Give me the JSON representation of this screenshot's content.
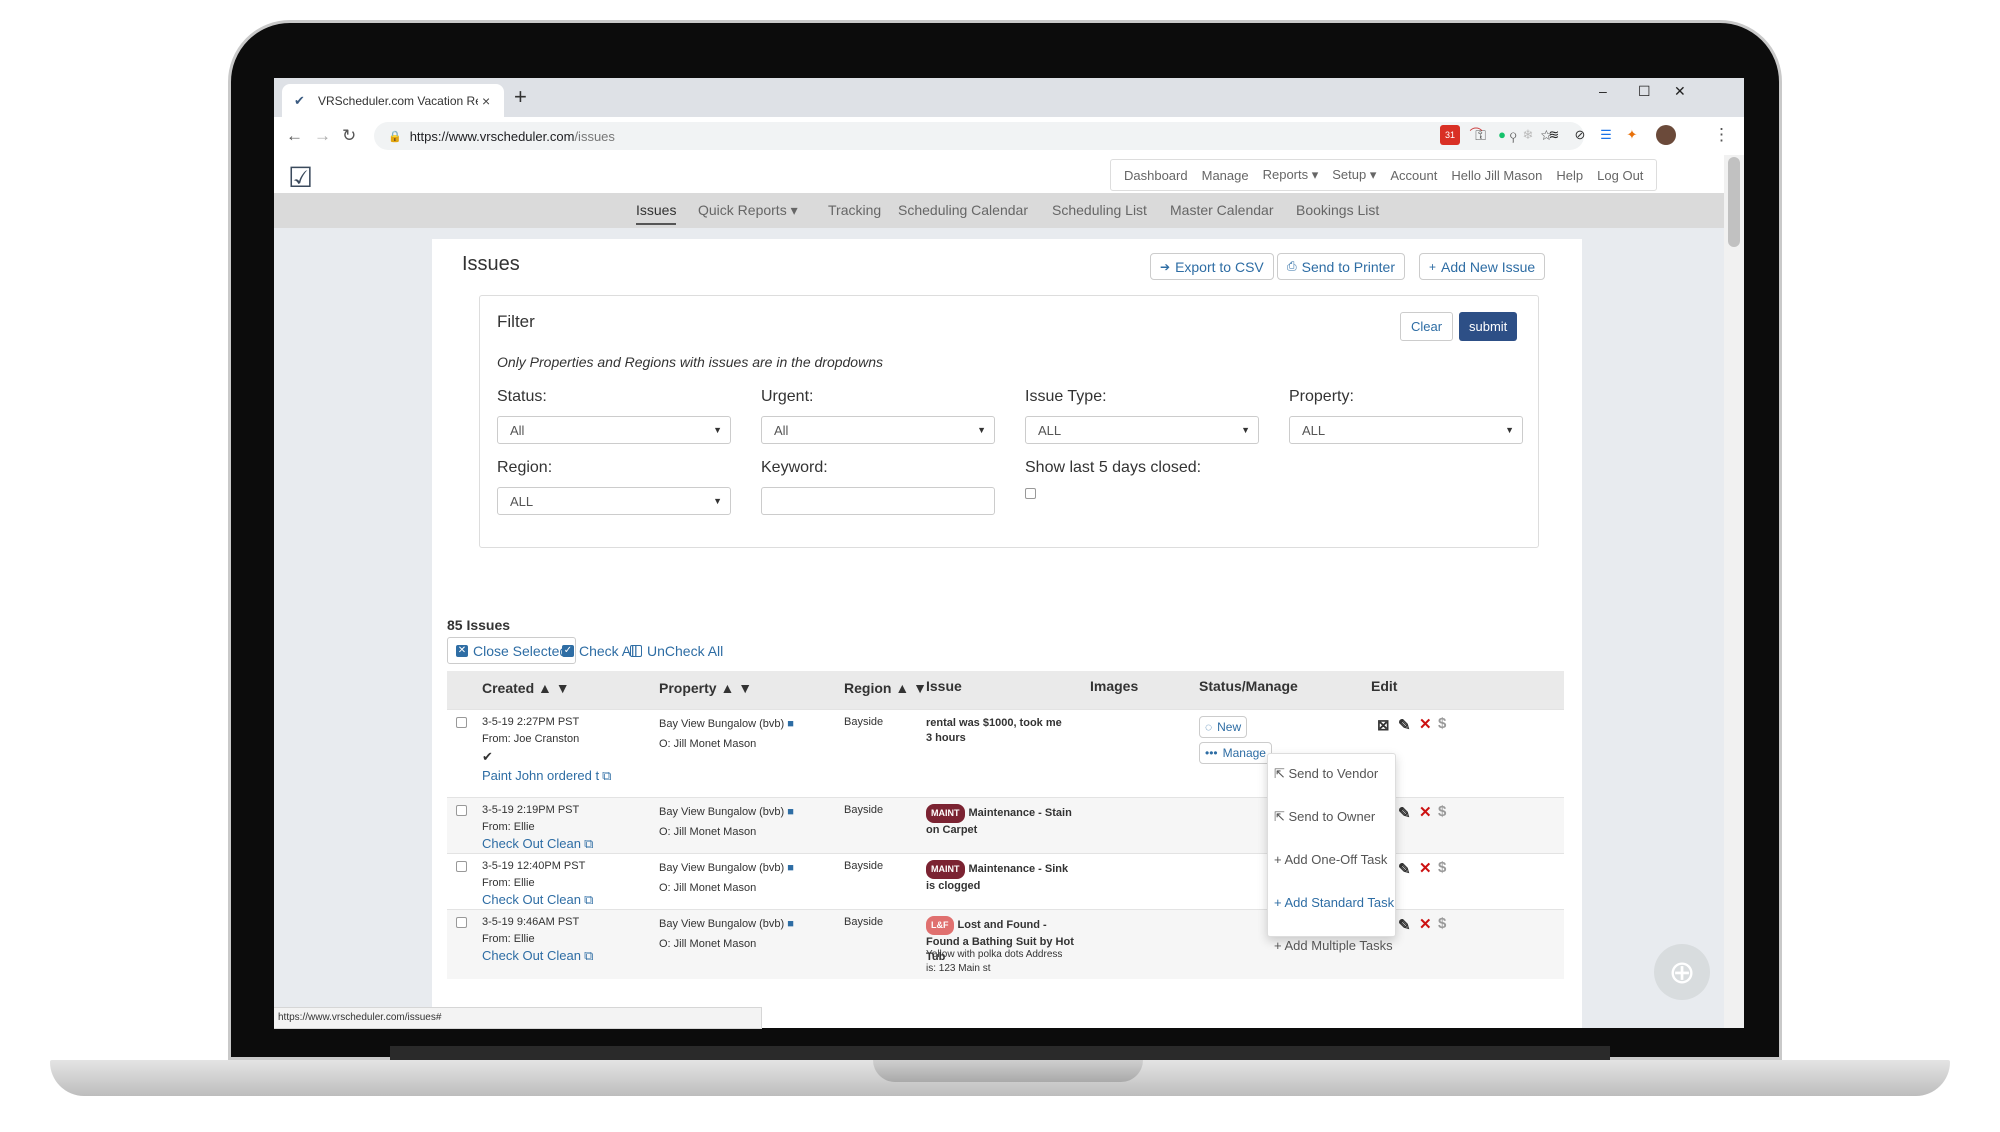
{
  "browser": {
    "tab_title": "VRScheduler.com Vacation Rental",
    "tab_close": "×",
    "new_tab": "+",
    "url_host": "https://www.vrscheduler.com",
    "url_path": "/issues",
    "window_minimize": "–",
    "window_restore": "☐",
    "window_close": "✕",
    "status_url": "https://www.vrscheduler.com/issues#"
  },
  "top_nav": {
    "links": [
      "Dashboard",
      "Manage",
      "Reports ▾",
      "Setup ▾",
      "Account",
      "Hello Jill Mason",
      "Help",
      "Log Out"
    ]
  },
  "sub_nav": {
    "items": [
      "Issues",
      "Quick Reports ▾",
      "Tracking",
      "Scheduling Calendar",
      "Scheduling List",
      "Master Calendar",
      "Bookings List"
    ],
    "active": "Issues"
  },
  "page": {
    "title": "Issues",
    "export_label": "Export to CSV",
    "print_label": "Send to Printer",
    "add_label": "Add New Issue"
  },
  "filter": {
    "heading": "Filter",
    "note": "Only Properties and Regions with issues are in the dropdowns",
    "clear_label": "Clear",
    "submit_label": "submit",
    "status_label": "Status:",
    "status_value": "All",
    "urgent_label": "Urgent:",
    "urgent_value": "All",
    "issue_type_label": "Issue Type:",
    "issue_type_value": "ALL",
    "property_label": "Property:",
    "property_value": "ALL",
    "region_label": "Region:",
    "region_value": "ALL",
    "keyword_label": "Keyword:",
    "keyword_value": "",
    "show_closed_label": "Show last 5 days closed:"
  },
  "list": {
    "count": "85 Issues",
    "close_selected": "Close Selected",
    "check_all": "Check All",
    "uncheck_all": "UnCheck All"
  },
  "table": {
    "headers": {
      "created": "Created ▲ ▼",
      "property": "Property ▲ ▼",
      "region": "Region ▲ ▼",
      "issue": "Issue",
      "images": "Images",
      "status": "Status/Manage",
      "edit": "Edit"
    },
    "rows": [
      {
        "created": "3-5-19 2:27PM PST",
        "from": "From: Joe Cranston",
        "check": "✔",
        "task": "Paint John ordered t",
        "property": "Bay View Bungalow (bvb)",
        "owner": "O: Jill Monet Mason",
        "region": "Bayside",
        "badge": "",
        "issue_title": "rental was $1000, took me 3 hours",
        "issue_detail": "",
        "status": "New",
        "manage": "Manage"
      },
      {
        "created": "3-5-19 2:19PM PST",
        "from": "From: Ellie",
        "task": "Check Out Clean",
        "property": "Bay View Bungalow (bvb)",
        "owner": "O: Jill Monet Mason",
        "region": "Bayside",
        "badge": "MAINT",
        "issue_title": "Maintenance - Stain on Carpet",
        "issue_detail": ""
      },
      {
        "created": "3-5-19 12:40PM PST",
        "from": "From: Ellie",
        "task": "Check Out Clean",
        "property": "Bay View Bungalow (bvb)",
        "owner": "O: Jill Monet Mason",
        "region": "Bayside",
        "badge": "MAINT",
        "issue_title": "Maintenance - Sink is clogged",
        "issue_detail": ""
      },
      {
        "created": "3-5-19 9:46AM PST",
        "from": "From: Ellie",
        "task": "Check Out Clean",
        "property": "Bay View Bungalow (bvb)",
        "owner": "O: Jill Monet Mason",
        "region": "Bayside",
        "badge": "L&F",
        "issue_title": "Lost and Found - Found a Bathing Suit by Hot Tub",
        "issue_detail": "Yellow with polka dots Address is: 123 Main st"
      }
    ]
  },
  "manage_menu": {
    "items": [
      "Send to Vendor",
      "Send to Owner",
      "Add One-Off Task",
      "Add Standard Task",
      "Add Multiple Tasks"
    ],
    "hovered": "Add Standard Task"
  },
  "colors": {
    "accent": "#2e6da4",
    "submit_bg": "#2d4f86",
    "maint_badge": "#7b2332",
    "lf_badge": "#e0706f",
    "delete": "#cc1111"
  },
  "icons": [
    "export-icon",
    "printer-icon",
    "plus-icon",
    "folder-icon",
    "external-link-icon",
    "close-square-icon",
    "pencil-icon",
    "delete-x-icon",
    "dollar-icon",
    "help-lifebuoy-icon"
  ]
}
